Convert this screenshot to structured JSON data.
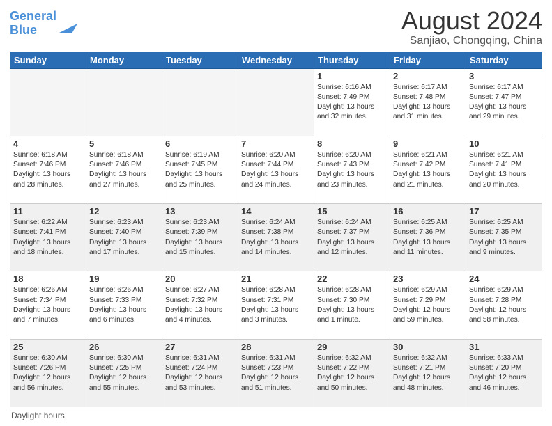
{
  "logo": {
    "line1": "General",
    "line2": "Blue"
  },
  "header": {
    "title": "August 2024",
    "subtitle": "Sanjiao, Chongqing, China"
  },
  "days_of_week": [
    "Sunday",
    "Monday",
    "Tuesday",
    "Wednesday",
    "Thursday",
    "Friday",
    "Saturday"
  ],
  "footer_label": "Daylight hours",
  "weeks": [
    [
      {
        "day": "",
        "info": ""
      },
      {
        "day": "",
        "info": ""
      },
      {
        "day": "",
        "info": ""
      },
      {
        "day": "",
        "info": ""
      },
      {
        "day": "1",
        "info": "Sunrise: 6:16 AM\nSunset: 7:49 PM\nDaylight: 13 hours\nand 32 minutes."
      },
      {
        "day": "2",
        "info": "Sunrise: 6:17 AM\nSunset: 7:48 PM\nDaylight: 13 hours\nand 31 minutes."
      },
      {
        "day": "3",
        "info": "Sunrise: 6:17 AM\nSunset: 7:47 PM\nDaylight: 13 hours\nand 29 minutes."
      }
    ],
    [
      {
        "day": "4",
        "info": "Sunrise: 6:18 AM\nSunset: 7:46 PM\nDaylight: 13 hours\nand 28 minutes."
      },
      {
        "day": "5",
        "info": "Sunrise: 6:18 AM\nSunset: 7:46 PM\nDaylight: 13 hours\nand 27 minutes."
      },
      {
        "day": "6",
        "info": "Sunrise: 6:19 AM\nSunset: 7:45 PM\nDaylight: 13 hours\nand 25 minutes."
      },
      {
        "day": "7",
        "info": "Sunrise: 6:20 AM\nSunset: 7:44 PM\nDaylight: 13 hours\nand 24 minutes."
      },
      {
        "day": "8",
        "info": "Sunrise: 6:20 AM\nSunset: 7:43 PM\nDaylight: 13 hours\nand 23 minutes."
      },
      {
        "day": "9",
        "info": "Sunrise: 6:21 AM\nSunset: 7:42 PM\nDaylight: 13 hours\nand 21 minutes."
      },
      {
        "day": "10",
        "info": "Sunrise: 6:21 AM\nSunset: 7:41 PM\nDaylight: 13 hours\nand 20 minutes."
      }
    ],
    [
      {
        "day": "11",
        "info": "Sunrise: 6:22 AM\nSunset: 7:41 PM\nDaylight: 13 hours\nand 18 minutes."
      },
      {
        "day": "12",
        "info": "Sunrise: 6:23 AM\nSunset: 7:40 PM\nDaylight: 13 hours\nand 17 minutes."
      },
      {
        "day": "13",
        "info": "Sunrise: 6:23 AM\nSunset: 7:39 PM\nDaylight: 13 hours\nand 15 minutes."
      },
      {
        "day": "14",
        "info": "Sunrise: 6:24 AM\nSunset: 7:38 PM\nDaylight: 13 hours\nand 14 minutes."
      },
      {
        "day": "15",
        "info": "Sunrise: 6:24 AM\nSunset: 7:37 PM\nDaylight: 13 hours\nand 12 minutes."
      },
      {
        "day": "16",
        "info": "Sunrise: 6:25 AM\nSunset: 7:36 PM\nDaylight: 13 hours\nand 11 minutes."
      },
      {
        "day": "17",
        "info": "Sunrise: 6:25 AM\nSunset: 7:35 PM\nDaylight: 13 hours\nand 9 minutes."
      }
    ],
    [
      {
        "day": "18",
        "info": "Sunrise: 6:26 AM\nSunset: 7:34 PM\nDaylight: 13 hours\nand 7 minutes."
      },
      {
        "day": "19",
        "info": "Sunrise: 6:26 AM\nSunset: 7:33 PM\nDaylight: 13 hours\nand 6 minutes."
      },
      {
        "day": "20",
        "info": "Sunrise: 6:27 AM\nSunset: 7:32 PM\nDaylight: 13 hours\nand 4 minutes."
      },
      {
        "day": "21",
        "info": "Sunrise: 6:28 AM\nSunset: 7:31 PM\nDaylight: 13 hours\nand 3 minutes."
      },
      {
        "day": "22",
        "info": "Sunrise: 6:28 AM\nSunset: 7:30 PM\nDaylight: 13 hours\nand 1 minute."
      },
      {
        "day": "23",
        "info": "Sunrise: 6:29 AM\nSunset: 7:29 PM\nDaylight: 12 hours\nand 59 minutes."
      },
      {
        "day": "24",
        "info": "Sunrise: 6:29 AM\nSunset: 7:28 PM\nDaylight: 12 hours\nand 58 minutes."
      }
    ],
    [
      {
        "day": "25",
        "info": "Sunrise: 6:30 AM\nSunset: 7:26 PM\nDaylight: 12 hours\nand 56 minutes."
      },
      {
        "day": "26",
        "info": "Sunrise: 6:30 AM\nSunset: 7:25 PM\nDaylight: 12 hours\nand 55 minutes."
      },
      {
        "day": "27",
        "info": "Sunrise: 6:31 AM\nSunset: 7:24 PM\nDaylight: 12 hours\nand 53 minutes."
      },
      {
        "day": "28",
        "info": "Sunrise: 6:31 AM\nSunset: 7:23 PM\nDaylight: 12 hours\nand 51 minutes."
      },
      {
        "day": "29",
        "info": "Sunrise: 6:32 AM\nSunset: 7:22 PM\nDaylight: 12 hours\nand 50 minutes."
      },
      {
        "day": "30",
        "info": "Sunrise: 6:32 AM\nSunset: 7:21 PM\nDaylight: 12 hours\nand 48 minutes."
      },
      {
        "day": "31",
        "info": "Sunrise: 6:33 AM\nSunset: 7:20 PM\nDaylight: 12 hours\nand 46 minutes."
      }
    ]
  ]
}
